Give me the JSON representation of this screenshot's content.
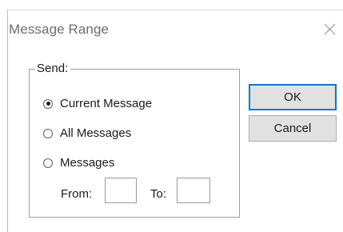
{
  "dialog": {
    "title": "Message Range",
    "close_icon": "close-icon"
  },
  "send_group": {
    "legend": "Send:",
    "options": [
      {
        "label": "Current Message",
        "checked": true
      },
      {
        "label": "All Messages",
        "checked": false
      },
      {
        "label": "Messages",
        "checked": false
      }
    ],
    "from_label": "From:",
    "from_value": "",
    "to_label": "To:",
    "to_value": ""
  },
  "buttons": {
    "ok": "OK",
    "cancel": "Cancel"
  },
  "colors": {
    "accent": "#0078d7",
    "button_face": "#e1e1e1"
  }
}
